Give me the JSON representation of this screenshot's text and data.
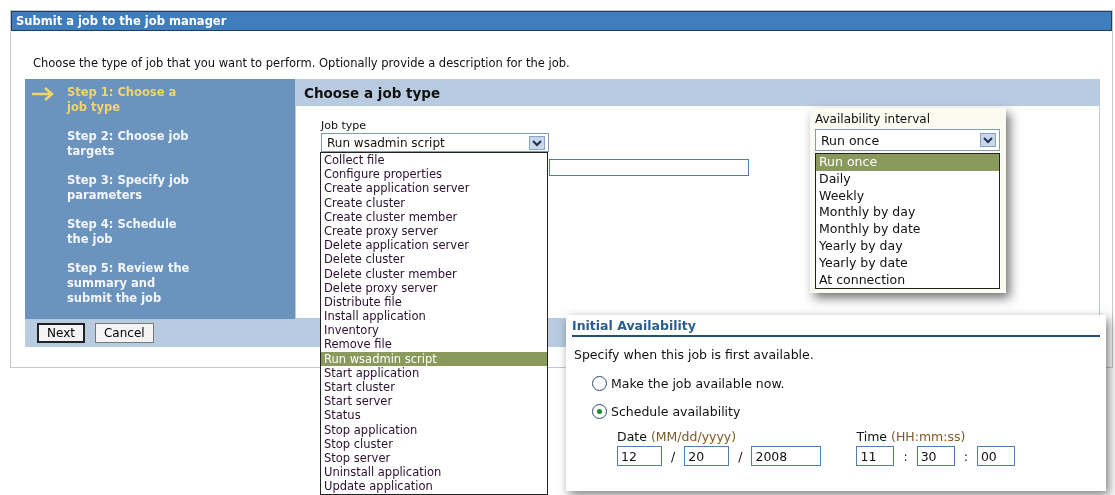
{
  "window": {
    "title": "Submit a job to the job manager"
  },
  "instructions": "Choose the type of job that you want to perform. Optionally provide a description for the job.",
  "steps": [
    {
      "label": "Step 1: Choose a job type",
      "selected": true
    },
    {
      "label": "Step 2: Choose job targets",
      "selected": false
    },
    {
      "label": "Step 3: Specify job parameters",
      "selected": false
    },
    {
      "label": "Step 4: Schedule the job",
      "selected": false
    },
    {
      "label": "Step 5: Review the summary and submit the job",
      "selected": false
    }
  ],
  "panel": {
    "title": "Choose a job type"
  },
  "job_type": {
    "label": "Job type",
    "value": "Run wsadmin script",
    "options": [
      {
        "label": "Collect file",
        "selected": false
      },
      {
        "label": "Configure properties",
        "selected": false
      },
      {
        "label": "Create application server",
        "selected": false
      },
      {
        "label": "Create cluster",
        "selected": false
      },
      {
        "label": "Create cluster member",
        "selected": false
      },
      {
        "label": "Create proxy server",
        "selected": false
      },
      {
        "label": "Delete application server",
        "selected": false
      },
      {
        "label": "Delete cluster",
        "selected": false
      },
      {
        "label": "Delete cluster member",
        "selected": false
      },
      {
        "label": "Delete proxy server",
        "selected": false
      },
      {
        "label": "Distribute file",
        "selected": false
      },
      {
        "label": "Install application",
        "selected": false
      },
      {
        "label": "Inventory",
        "selected": false
      },
      {
        "label": "Remove file",
        "selected": false
      },
      {
        "label": "Run wsadmin script",
        "selected": true
      },
      {
        "label": "Start application",
        "selected": false
      },
      {
        "label": "Start cluster",
        "selected": false
      },
      {
        "label": "Start server",
        "selected": false
      },
      {
        "label": "Status",
        "selected": false
      },
      {
        "label": "Stop application",
        "selected": false
      },
      {
        "label": "Stop cluster",
        "selected": false
      },
      {
        "label": "Stop server",
        "selected": false
      },
      {
        "label": "Uninstall application",
        "selected": false
      },
      {
        "label": "Update application",
        "selected": false
      }
    ]
  },
  "availability_interval": {
    "label": "Availability interval",
    "value": "Run once",
    "options": [
      {
        "label": "Run once",
        "selected": true
      },
      {
        "label": "Daily",
        "selected": false
      },
      {
        "label": "Weekly",
        "selected": false
      },
      {
        "label": "Monthly by day",
        "selected": false
      },
      {
        "label": "Monthly by date",
        "selected": false
      },
      {
        "label": "Yearly by day",
        "selected": false
      },
      {
        "label": "Yearly by date",
        "selected": false
      },
      {
        "label": "At connection",
        "selected": false
      }
    ]
  },
  "buttons": [
    "Next",
    "Cancel"
  ],
  "initial_availability": {
    "title": "Initial Availability",
    "description": "Specify when this job is first available.",
    "options": [
      {
        "label": "Make the job available now.",
        "selected": false
      },
      {
        "label": "Schedule availability",
        "selected": true
      }
    ],
    "date_label": "Date",
    "date_format": "(MM/dd/yyyy)",
    "date_fields": [
      {
        "value": "12"
      },
      {
        "separator": "/",
        "value": "20"
      },
      {
        "separator": "/",
        "value": "2008"
      }
    ],
    "time_label": "Time",
    "time_format": "(HH:mm:ss)",
    "time_fields": [
      {
        "value": "11"
      },
      {
        "separator": ":",
        "value": "30"
      },
      {
        "separator": ":",
        "value": "00"
      }
    ]
  }
}
